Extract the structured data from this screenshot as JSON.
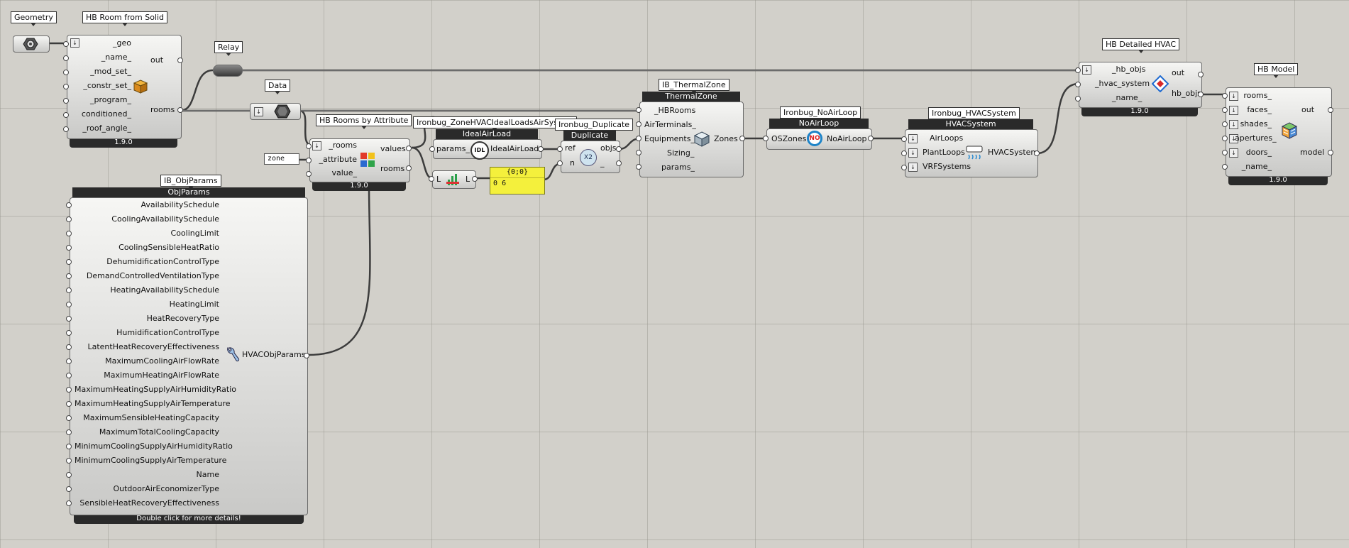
{
  "labels": {
    "geometry": "Geometry",
    "room_from_solid": "HB Room from Solid",
    "relay": "Relay",
    "data": "Data",
    "rooms_by_attribute": "HB Rooms by Attribute",
    "ideal_loads": "Ironbug_ZoneHVACIdealLoadsAirSystem",
    "duplicate": "Ironbug_Duplicate",
    "thermal_zone": "IB_ThermalZone",
    "no_air_loop": "Ironbug_NoAirLoop",
    "hvac_system": "Ironbug_HVACSystem",
    "detailed_hvac": "HB Detailed HVAC",
    "model": "HB Model",
    "obj_params": "IB_ObjParams"
  },
  "room_from_solid": {
    "inputs": [
      "_geo",
      "_name_",
      "_mod_set_",
      "_constr_set_",
      "_program_",
      "conditioned_",
      "_roof_angle_"
    ],
    "output_out": "out",
    "output_rooms": "rooms",
    "version": "1.9.0"
  },
  "panel_zone": "zone",
  "rooms_by_attribute": {
    "inputs": [
      "_rooms",
      "_attribute",
      "value_"
    ],
    "outputs": [
      "values",
      "rooms"
    ],
    "version": "1.9.0"
  },
  "ideal_loads": {
    "title": "IdealAirLoad",
    "input": "params_",
    "output": "IdealAirLoad",
    "icon_text": "IDL"
  },
  "list_len": {
    "input": "L",
    "output": "L"
  },
  "yellow_panel": {
    "header": "{0;0}",
    "index": "0",
    "value": "6"
  },
  "duplicate": {
    "title": "Duplicate",
    "inputs": [
      "ref",
      "n"
    ],
    "outputs": [
      "objs",
      "_"
    ],
    "icon_text": "X2"
  },
  "thermal_zone": {
    "title": "ThermalZone",
    "inputs": [
      "_HBRooms",
      "AirTerminals_",
      "Equipments_",
      "Sizing_",
      "params_"
    ],
    "output": "Zones"
  },
  "no_air_loop": {
    "title": "NoAirLoop",
    "input": "OSZones",
    "output": "NoAirLoop",
    "icon_text": "NO"
  },
  "hvac_system": {
    "title": "HVACSystem",
    "inputs": [
      "AirLoops",
      "PlantLoops",
      "VRFSystems"
    ],
    "output": "HVACSystem"
  },
  "detailed_hvac": {
    "inputs": [
      "_hb_objs",
      "_hvac_system",
      "_name_"
    ],
    "outputs": [
      "out",
      "hb_objs"
    ],
    "version": "1.9.0"
  },
  "model": {
    "inputs": [
      "rooms_",
      "faces_",
      "shades_",
      "apertures_",
      "doors_",
      "_name_"
    ],
    "outputs": [
      "out",
      "model"
    ],
    "version": "1.9.0"
  },
  "obj_params": {
    "title": "ObjParams",
    "inputs": [
      "AvailabilitySchedule",
      "CoolingAvailabilitySchedule",
      "CoolingLimit",
      "CoolingSensibleHeatRatio",
      "DehumidificationControlType",
      "DemandControlledVentilationType",
      "HeatingAvailabilitySchedule",
      "HeatingLimit",
      "HeatRecoveryType",
      "HumidificationControlType",
      "LatentHeatRecoveryEffectiveness",
      "MaximumCoolingAirFlowRate",
      "MaximumHeatingAirFlowRate",
      "MaximumHeatingSupplyAirHumidityRatio",
      "MaximumHeatingSupplyAirTemperature",
      "MaximumSensibleHeatingCapacity",
      "MaximumTotalCoolingCapacity",
      "MinimumCoolingSupplyAirHumidityRatio",
      "MinimumCoolingSupplyAirTemperature",
      "Name",
      "OutdoorAirEconomizerType",
      "SensibleHeatRecoveryEffectiveness"
    ],
    "output": "HVACObjParams",
    "footer": "Double click for more details!"
  },
  "colors": {
    "canvas": "#d2d0ca",
    "header": "#2a2a2a",
    "panel_yellow": "#f4f03c"
  }
}
